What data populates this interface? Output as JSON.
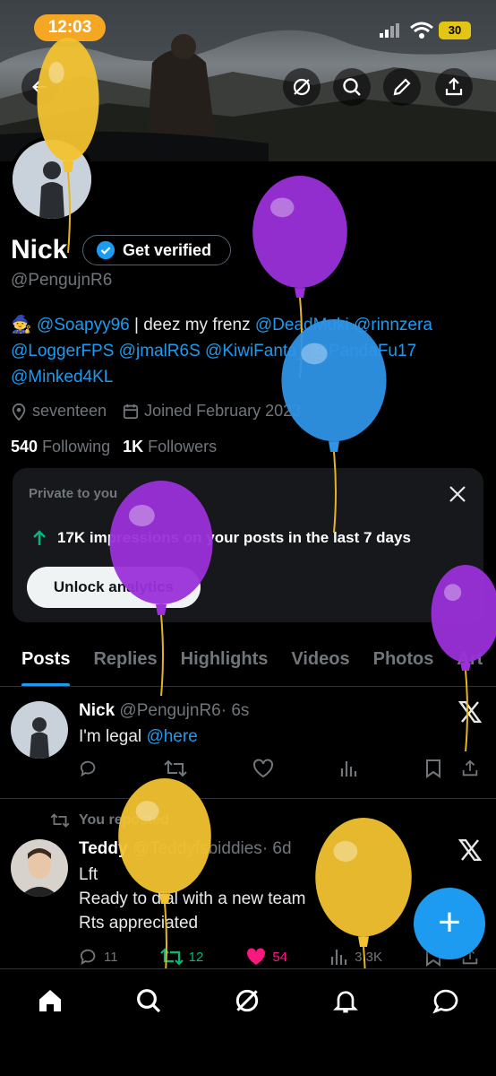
{
  "status": {
    "time": "12:03",
    "battery": "30"
  },
  "profile": {
    "name": "Nick",
    "verify_label": "Get verified",
    "handle": "@PengujnR6",
    "bio_emoji": "🧙",
    "bio_mentions_1": "@Soapyy96",
    "bio_sep": " | deez my frenz ",
    "bio_mentions_2": "@DeadMuki @rinnzera",
    "bio_mentions_3": "@LoggerFPS @jmalR6S @KiwiFanta_ @PandaFu17",
    "bio_mentions_4": "@Minked4KL",
    "location": "seventeen",
    "joined": "Joined February 2023",
    "following_count": "540",
    "following_label": "Following",
    "followers_count": "1K",
    "followers_label": "Followers"
  },
  "private_card": {
    "title": "Private to you",
    "stat": "17K impressions on your posts in the last 7 days",
    "button": "Unlock analytics"
  },
  "tabs": [
    "Posts",
    "Replies",
    "Highlights",
    "Videos",
    "Photos",
    "Art"
  ],
  "posts": [
    {
      "name": "Nick",
      "handle": "@PengujnR6",
      "time": "· 6s",
      "text_plain": "I'm legal ",
      "text_mention": "@here",
      "replies": "",
      "reposts": "",
      "likes": "",
      "views": ""
    },
    {
      "repost_label": "You reposted",
      "name": "Teddy",
      "handle": "@Teddyfsbiddies",
      "time": "· 6d",
      "lines": [
        "Lft",
        "Ready to dial with a new team",
        "Rts appreciated"
      ],
      "replies": "11",
      "reposts": "12",
      "likes": "54",
      "views": "3.3K"
    }
  ],
  "fab_label": "+",
  "colors": {
    "accent": "#1d9bf0",
    "like": "#f91880",
    "repost": "#00ba7c",
    "balloon_yellow": "#f2c230",
    "balloon_purple": "#9b30d9",
    "balloon_blue": "#2f93e6"
  },
  "icons": [
    "back-arrow-icon",
    "grok-icon",
    "search-icon",
    "edit-icon",
    "share-icon",
    "verified-badge-icon",
    "location-icon",
    "calendar-icon",
    "close-icon",
    "trend-up-icon",
    "reply-icon",
    "repost-icon",
    "like-icon",
    "views-icon",
    "bookmark-icon",
    "home-icon",
    "notifications-icon",
    "messages-icon",
    "x-logo-icon"
  ]
}
